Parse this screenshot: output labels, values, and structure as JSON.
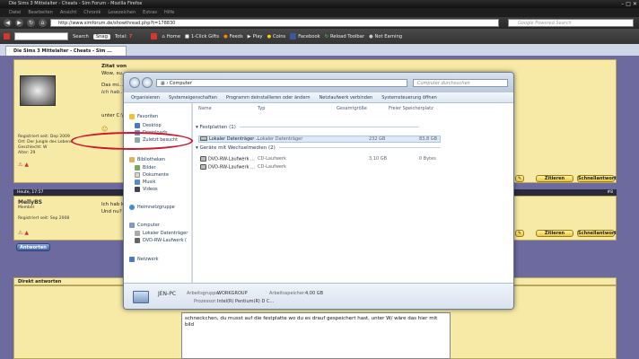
{
  "browser": {
    "title": "Die Sims 3 Mittelalter - Cheats - Sim Forum - Mozilla Firefox",
    "menu": [
      "Datei",
      "Bearbeiten",
      "Ansicht",
      "Chronik",
      "Lesezeichen",
      "Extras",
      "Hilfe"
    ],
    "url": "http://www.simforum.de/showthread.php?t=178830",
    "search_placeholder": "Google Powered Search",
    "tab_title": "Die Sims 3 Mittelalter - Cheats - Sim ..."
  },
  "toolbar": {
    "search_label": "Search",
    "snag_label": "Snag",
    "total_label": "Total:",
    "total_value": "7",
    "items": [
      "Home",
      "1-Click Gifts",
      "Feeds",
      "Play",
      "Coins",
      "Facebook",
      "Reload Toolbar",
      "Not Earning"
    ]
  },
  "forum": {
    "post1": {
      "quote_header": "Zitat von MellyBS",
      "quote_line1": "Wow, su...",
      "quote_line2": "Das mi...",
      "quote_line3": "Ich hab...",
      "body_fragment": "unter C:\\Pro",
      "info": [
        "Registriert seit: Dep 2009",
        "Ort: Der Jungle des Lebens",
        "Geschlecht: W",
        "Alter: 29"
      ]
    },
    "post2": {
      "date": "Heute, 17:57",
      "username": "MellyBS",
      "rank": "Member",
      "info": "Registriert seit: Sep 2008",
      "body_line1": "Ich hab ke",
      "body_line2": "Und nu?",
      "postnum": "#8"
    },
    "btn_zitieren": "Zitieren",
    "btn_schnellantwort": "Schnellantwort",
    "btn_antworten": "Antworten",
    "reply_header": "Direkt antworten",
    "reply_text": "schneckchen, du musst auf die festplatte wo du es drauf gespeichert hast, unter W/ wäre das hier mit bild"
  },
  "explorer": {
    "address": "Computer",
    "search_placeholder": "Computer durchsuchen",
    "commands": [
      "Organisieren",
      "Systemeigenschaften",
      "Programm deinstallieren oder ändern",
      "Netzlaufwerk verbinden",
      "Systemsteuerung öffnen"
    ],
    "nav": {
      "favoriten": "Favoriten",
      "fav_items": [
        "Desktop",
        "Downloads",
        "Zuletzt besucht"
      ],
      "bibliotheken": "Bibliotheken",
      "lib_items": [
        "Bilder",
        "Dokumente",
        "Musik",
        "Videos"
      ],
      "heimnetzgruppe": "Heimnetzgruppe",
      "computer": "Computer",
      "comp_items": [
        "Lokaler Datenträger",
        "DVD-RW-Laufwerk ("
      ],
      "netzwerk": "Netzwerk"
    },
    "columns": {
      "name": "Name",
      "typ": "Typ",
      "gesamt": "Gesamtgröße",
      "frei": "Freier Speicherplatz"
    },
    "group1": "Festplatten (1)",
    "group2": "Geräte mit Wechselmedien (2)",
    "drives": [
      {
        "name": "Lokaler Datenträger ...",
        "typ": "Lokaler Datenträger",
        "gesamt": "232 GB",
        "frei": "83,8 GB"
      },
      {
        "name": "DVD-RW-Laufwerk ...",
        "typ": "CD-Laufwerk",
        "gesamt": "3,10 GB",
        "frei": "0 Bytes"
      },
      {
        "name": "DVD-RW-Laufwerk ...",
        "typ": "CD-Laufwerk",
        "gesamt": "",
        "frei": ""
      }
    ],
    "details": {
      "pc_name": "JEN-PC",
      "workgroup_label": "Arbeitsgruppe:",
      "workgroup_value": "WORKGROUP",
      "memory_label": "Arbeitsspeicher:",
      "memory_value": "4,00 GB",
      "processor_label": "Prozessor:",
      "processor_value": "Intel(R) Pentium(R) D C..."
    }
  },
  "colors": {
    "highlight_circle": "#d0142a",
    "forum_bg": "#6d6a9f",
    "post_bg": "#f7e9a6"
  }
}
